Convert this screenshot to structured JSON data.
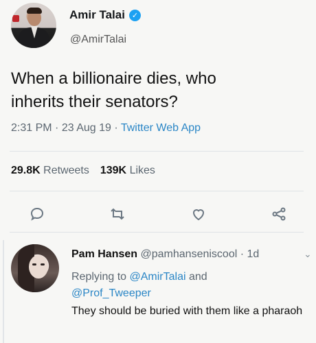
{
  "tweet": {
    "display_name": "Amir Talai",
    "handle": "@AmirTalai",
    "text_line1": "When a billionaire dies, who",
    "text_line2": "inherits their senators?",
    "time": "2:31 PM",
    "date": "23 Aug 19",
    "app": "Twitter Web App",
    "retweets_count": "29.8K",
    "retweets_label": "Retweets",
    "likes_count": "139K",
    "likes_label": "Likes"
  },
  "icons": {
    "verified": "verified-badge-icon",
    "reply": "reply-icon",
    "retweet": "retweet-icon",
    "like": "heart-icon",
    "share": "share-icon",
    "chevron": "chevron-down-icon"
  },
  "reply": {
    "display_name": "Pam Hansen",
    "handle": "@pamhanseniscool",
    "age": "1d",
    "replying_to_label": "Replying to",
    "mention1": "@AmirTalai",
    "and_label": "and",
    "mention2": "@Prof_Tweeper",
    "text": "They should be buried with them like a pharaoh"
  },
  "colors": {
    "link": "#2a86c6",
    "verified": "#1da1f2"
  }
}
